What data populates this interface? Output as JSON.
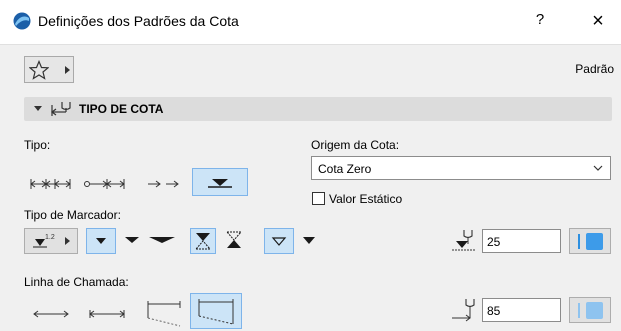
{
  "window": {
    "title": "Definições dos Padrões da Cota",
    "help_label": "?",
    "close_label": "×"
  },
  "toolbar": {
    "preset_label": "Padrão"
  },
  "section": {
    "title": "TIPO DE COTA"
  },
  "tipo": {
    "label": "Tipo:"
  },
  "origem": {
    "label": "Origem da Cota:",
    "selected": "Cota Zero",
    "static_label": "Valor Estático",
    "static_checked": false
  },
  "marcador": {
    "label": "Tipo de Marcador:",
    "size_value": "25",
    "pen_color": "#3d9be9"
  },
  "chamada": {
    "label": "Linha de Chamada:",
    "length_value": "85",
    "pen_color": "#8ec3ef"
  },
  "colors": {
    "accent": "#3d9be9",
    "selected_bg": "#cce4f7",
    "section_bg": "#dcdcdc"
  }
}
